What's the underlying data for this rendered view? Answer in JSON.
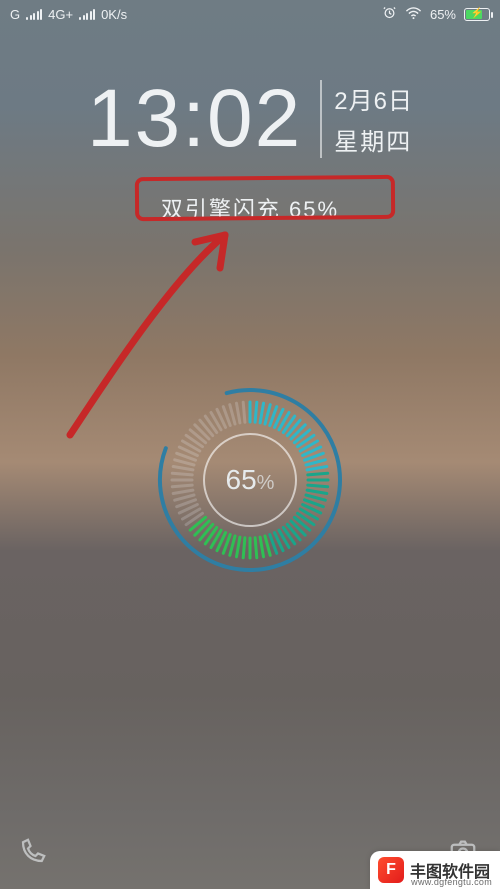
{
  "status_bar": {
    "carrier_letter": "G",
    "network_type": "4G+",
    "data_rate": "0K/s",
    "battery_pct_text": "65%"
  },
  "clock": {
    "time": "13:02",
    "date": "2月6日",
    "day_of_week": "星期四"
  },
  "charging": {
    "text_full": "双引擎闪充 65%",
    "ring_pct_num": "65",
    "ring_pct_sym": "%",
    "percent": 65
  },
  "watermark": {
    "logo_letter": "F",
    "name": "丰图软件园",
    "url": "www.dgfengtu.com"
  }
}
